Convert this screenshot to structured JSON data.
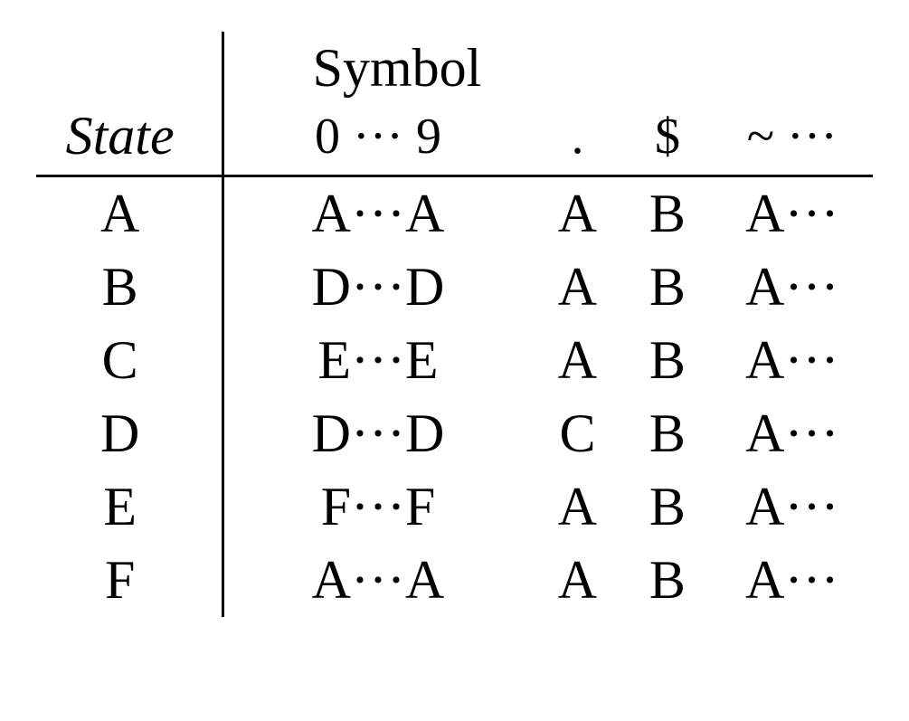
{
  "chart_data": {
    "type": "table",
    "title": "",
    "column_group_label": "Symbol",
    "row_header": "State",
    "columns": [
      "0 ··· 9",
      ".",
      "$",
      "~ ···"
    ],
    "rows": [
      {
        "state": "A",
        "cells": [
          "A···A",
          "A",
          "B",
          "A···"
        ]
      },
      {
        "state": "B",
        "cells": [
          "D···D",
          "A",
          "B",
          "A···"
        ]
      },
      {
        "state": "C",
        "cells": [
          "E···E",
          "A",
          "B",
          "A···"
        ]
      },
      {
        "state": "D",
        "cells": [
          "D···D",
          "C",
          "B",
          "A···"
        ]
      },
      {
        "state": "E",
        "cells": [
          "F···F",
          "A",
          "B",
          "A···"
        ]
      },
      {
        "state": "F",
        "cells": [
          "A···A",
          "A",
          "B",
          "A···"
        ]
      }
    ]
  }
}
